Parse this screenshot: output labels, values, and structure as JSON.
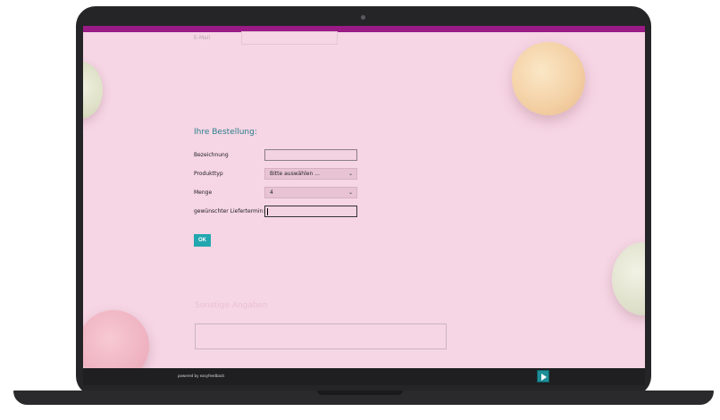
{
  "contact": {
    "email_label": "E-Mail"
  },
  "order": {
    "title": "Ihre Bestellung:",
    "fields": [
      {
        "label": "Bezeichnung",
        "value": ""
      },
      {
        "label": "Produkttyp",
        "value": "Bitte auswählen ..."
      },
      {
        "label": "Menge",
        "value": "4"
      },
      {
        "label": "gewünschter Liefertermin:",
        "value": ""
      }
    ],
    "submit_label": "OK"
  },
  "other": {
    "title": "Sonstige Angaben"
  },
  "footer": {
    "powered_by": "powered by easyfeedback"
  },
  "icons": {
    "select_chevron": "chevron-down-icon",
    "next": "play-icon"
  },
  "colors": {
    "accent": "#22a7b0",
    "top_bar": "#9a1a86",
    "title": "#2a7f8c",
    "background": "#f6d5e4"
  }
}
